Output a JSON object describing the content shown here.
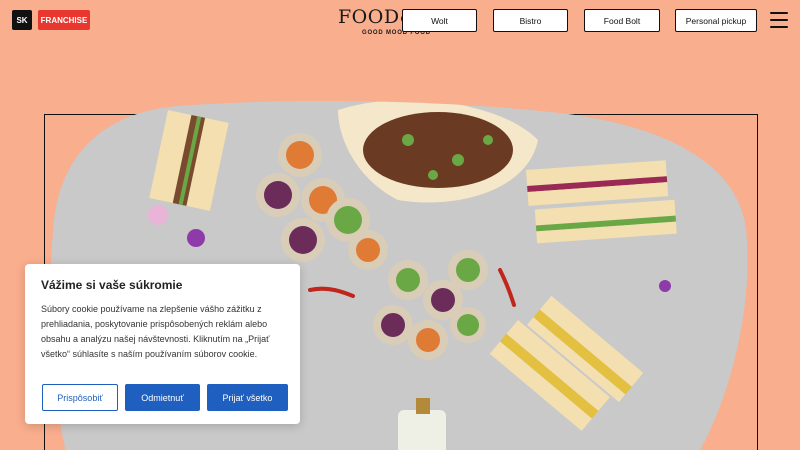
{
  "header": {
    "language": "SK",
    "franchise_label": "FRANCHISE",
    "logo_text": "FOOD&",
    "logo_tagline": "GOOD MOOD FOOD",
    "nav": [
      {
        "label": "Wolt"
      },
      {
        "label": "Bistro"
      },
      {
        "label": "Food Bolt"
      },
      {
        "label": "Personal pickup"
      }
    ],
    "menu_icon": "hamburger-menu-icon"
  },
  "hero": {
    "image_subject": "food-platter-photo"
  },
  "cookie_banner": {
    "title": "Vážime si vaše súkromie",
    "text": "Súbory cookie používame na zlepšenie vášho zážitku z prehliadania, poskytovanie prispôsobených reklám alebo obsahu a analýzu našej návštevnosti. Kliknutím na „Prijať všetko“ súhlasíte s naším používaním súborov cookie.",
    "customize_label": "Prispôsobiť",
    "reject_label": "Odmietnuť",
    "accept_label": "Prijať všetko"
  },
  "colors": {
    "background": "#f9ae8d",
    "franchise": "#e8372e",
    "button_blue": "#1f5fbf"
  }
}
